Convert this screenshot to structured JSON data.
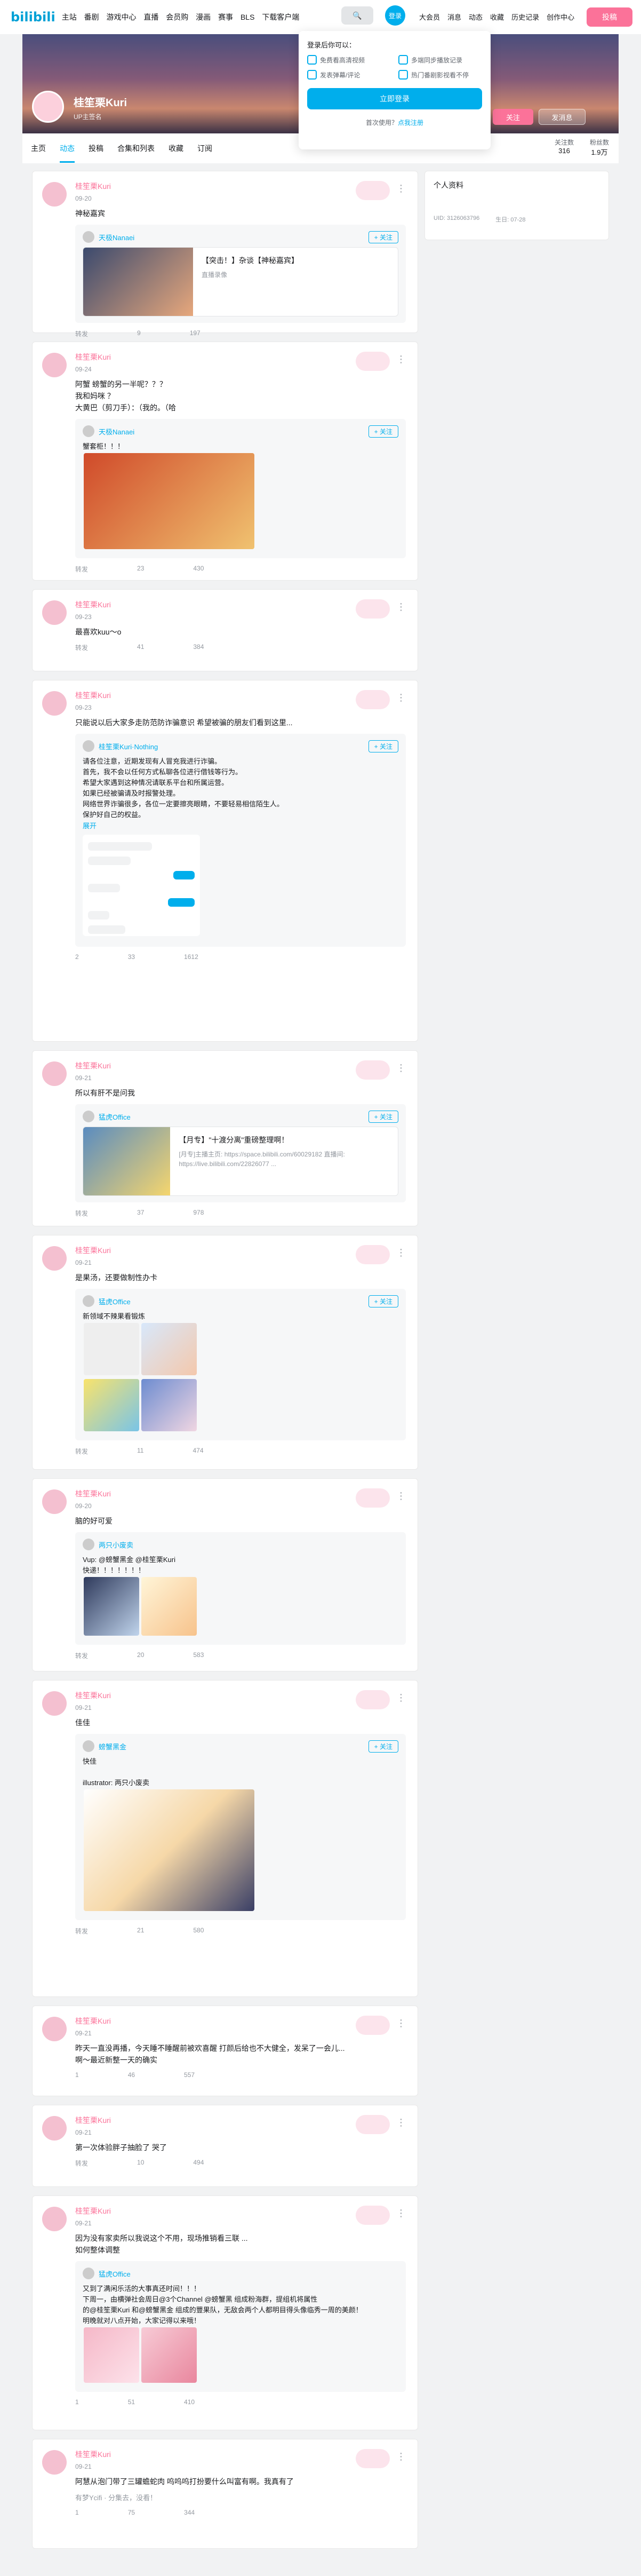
{
  "header": {
    "logo": "bilibili",
    "nav": [
      "主站",
      "番剧",
      "游戏中心",
      "直播",
      "会员购",
      "漫画",
      "赛事",
      "BLS",
      "下载客户端"
    ],
    "login": "登录",
    "right": [
      "大会员",
      "消息",
      "动态",
      "收藏",
      "历史记录",
      "创作中心"
    ],
    "upload": "投稿"
  },
  "popup": {
    "title": "登录后你可以：",
    "items": [
      "免费看高清视频",
      "多端同步播放记录",
      "发表弹幕/评论",
      "热门番剧影视看不停"
    ],
    "button": "立即登录",
    "register_prefix": "首次使用？",
    "register_link": "点我注册"
  },
  "profile": {
    "name": "桂笙栗Kuri",
    "sign": "UP主签名",
    "follow": "关注",
    "message": "发消息",
    "tabs": [
      "主页",
      "动态",
      "投稿",
      "合集和列表",
      "收藏",
      "订阅"
    ],
    "stats": [
      {
        "label": "关注数",
        "value": "316"
      },
      {
        "label": "粉丝数",
        "value": "1.9万"
      }
    ]
  },
  "side": {
    "title": "个人资料",
    "uid": "UID: 3126063796",
    "birthday": "生日: 07-28"
  },
  "posts": [
    {
      "name": "桂笙栗Kuri",
      "time": "09-20",
      "text": "神秘嘉宾",
      "repost_user": "天极Nanaei",
      "video_title": "【突击！】杂谈【神秘嘉宾】",
      "video_sub": "直播录像",
      "stats": [
        "转发",
        "9",
        "197"
      ]
    },
    {
      "name": "桂笙栗Kuri",
      "time": "09-24",
      "text": "阿蟹 螃蟹的另一半呢？？？\n我和妈咪 ？\n大黄巴（剪刀手）：（我的。（哈",
      "repost_user": "天极Nanaei",
      "repost_text": "蟹套柜！！！",
      "stats": [
        "转发",
        "23",
        "430"
      ]
    },
    {
      "name": "桂笙栗Kuri",
      "time": "09-23",
      "text": "最喜欢kuu～o",
      "stats": [
        "转发",
        "41",
        "384"
      ]
    },
    {
      "name": "桂笙栗Kuri",
      "time": "09-23",
      "text": "只能说以后大家多走防范防诈骗意识 希望被骗的朋友们看到这里...",
      "repost_user": "桂笙栗Kuri·Nothing",
      "repost_text": "请各位注意，近期发现有人冒充我进行诈骗。\n首先，我不会以任何方式私聊各位进行借钱等行为。\n希望大家遇到这种情况请联系平台和所属运营。\n如果已经被骗请及时报警处理。\n网络世界诈骗很多，各位一定要擦亮眼睛，不要轻易相信陌生人。\n保护好自己的权益。",
      "expand": "展开",
      "stats": [
        "2",
        "33",
        "1612"
      ]
    },
    {
      "name": "桂笙栗Kuri",
      "time": "09-21",
      "text": "所以有肝不是问我",
      "repost_user": "猛虎Office",
      "video_title": "【月专】\"十渡分离\"重磅整理啊！",
      "video_sub": "[月专]主播主页: https://space.bilibili.com/60029182 直播间: https://live.bilibili.com/22826077 ...",
      "stats": [
        "转发",
        "37",
        "978"
      ]
    },
    {
      "name": "桂笙栗Kuri",
      "time": "09-21",
      "text": "是果汤，还要做制性办卡",
      "repost_user": "猛虎Office",
      "repost_text": "新领域不辣果看锻炼",
      "stats": [
        "转发",
        "11",
        "474"
      ]
    },
    {
      "name": "桂笙栗Kuri",
      "time": "09-20",
      "text": "脑的好可爱",
      "repost_user": "两只小废卖",
      "repost_text": "Vup: @螃蟹黑金 @桂笙栗Kuri\n快递！！！！！！！",
      "stats": [
        "转发",
        "20",
        "583"
      ]
    },
    {
      "name": "桂笙栗Kuri",
      "time": "09-21",
      "text": "佳佳",
      "repost_user": "螃蟹黑金",
      "repost_text": "快佳\n\nillustrator: 两只小废卖",
      "stats": [
        "转发",
        "21",
        "580"
      ]
    },
    {
      "name": "桂笙栗Kuri",
      "time": "09-21",
      "text": "昨天一直没再播，今天睡不睡醒前被欢喜醒 打颜后给也不大健全，发呆了一会儿... \n啊～最近新整一天的确实",
      "stats": [
        "1",
        "46",
        "557"
      ]
    },
    {
      "name": "桂笙栗Kuri",
      "time": "09-21",
      "text": "第一次体验胖子抽脸了 哭了",
      "stats": [
        "转发",
        "10",
        "494"
      ]
    },
    {
      "name": "桂笙栗Kuri",
      "time": "09-21",
      "text": "因为没有家卖所以我说这个不用，现场推销看三联 ...\n如何整体调整",
      "repost_user": "猛虎Office",
      "repost_text": "又到了满闲乐活的大事真还时间！！！\n下周一，由横弹社会周日@3个Channel @螃蟹黑 组成粉海群，提组机将属性\n的@桂笙栗Kuri 和@螃蟹黑金 组成的豐果队，无敌会两个人都明目得头像临秀一周的美颜！\n明晚就对八点开始，大家记得以来哦！",
      "stats": [
        "1",
        "51",
        "410"
      ]
    },
    {
      "name": "桂笙栗Kuri",
      "time": "09-21",
      "text": "阿慧从泡门带了三罐蟾蛇肉 呜呜呜打扮要什么叫富有啊。我真有了",
      "repost_text": "有梦Ycifi · 分集去，没看！",
      "stats": [
        "1",
        "75",
        "344"
      ]
    }
  ]
}
